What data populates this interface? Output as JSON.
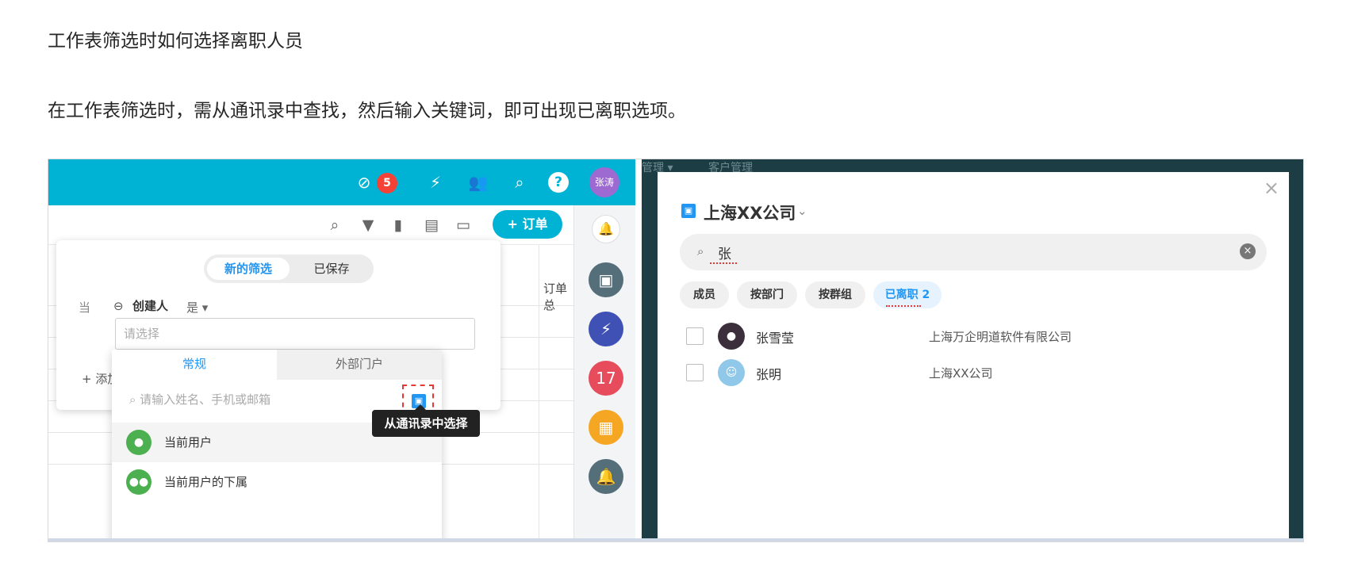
{
  "doc": {
    "title": "工作表筛选时如何选择离职人员",
    "paragraph": "在工作表筛选时，需从通讯录中查找，然后输入关键词，即可出现已离职选项。"
  },
  "left_app": {
    "topbar": {
      "tasks_badge": "5",
      "user_avatar": "张涛",
      "icons": [
        "check-circle-icon",
        "lightning-icon",
        "people-icon",
        "search-icon",
        "help-icon"
      ]
    },
    "toolbar": {
      "add_order": "+ 订单",
      "icons": [
        "search-icon",
        "filter-icon",
        "stats-icon",
        "comment-icon",
        "inbox-icon"
      ]
    },
    "sheet": {
      "column_header": "订单总"
    },
    "filter": {
      "tab_new": "新的筛选",
      "tab_saved": "已保存",
      "when_label": "当",
      "field_name": "创建人",
      "operator": "是 ▾",
      "select_placeholder": "请选择",
      "add_condition": "+ 添加"
    },
    "dropdown": {
      "tab_regular": "常规",
      "tab_external": "外部门户",
      "search_placeholder": "请输入姓名、手机或邮箱",
      "items": [
        {
          "label": "当前用户"
        },
        {
          "label": "当前用户的下属"
        }
      ]
    },
    "tooltip": "从通讯录中选择",
    "rail_colors": [
      "#546e7a",
      "#3f51b5",
      "#e74c5c",
      "#f5a623",
      "#546e7a"
    ]
  },
  "right_app": {
    "bg_text": [
      "管理 ▾",
      "客户管理"
    ],
    "org_name": "上海XX公司",
    "search_value": "张",
    "chips": [
      {
        "label": "成员"
      },
      {
        "label": "按部门"
      },
      {
        "label": "按群组"
      },
      {
        "label": "已离职 2"
      }
    ],
    "results": [
      {
        "name": "张雪莹",
        "org": "上海万企明道软件有限公司"
      },
      {
        "name": "张明",
        "org": "上海XX公司"
      }
    ]
  }
}
